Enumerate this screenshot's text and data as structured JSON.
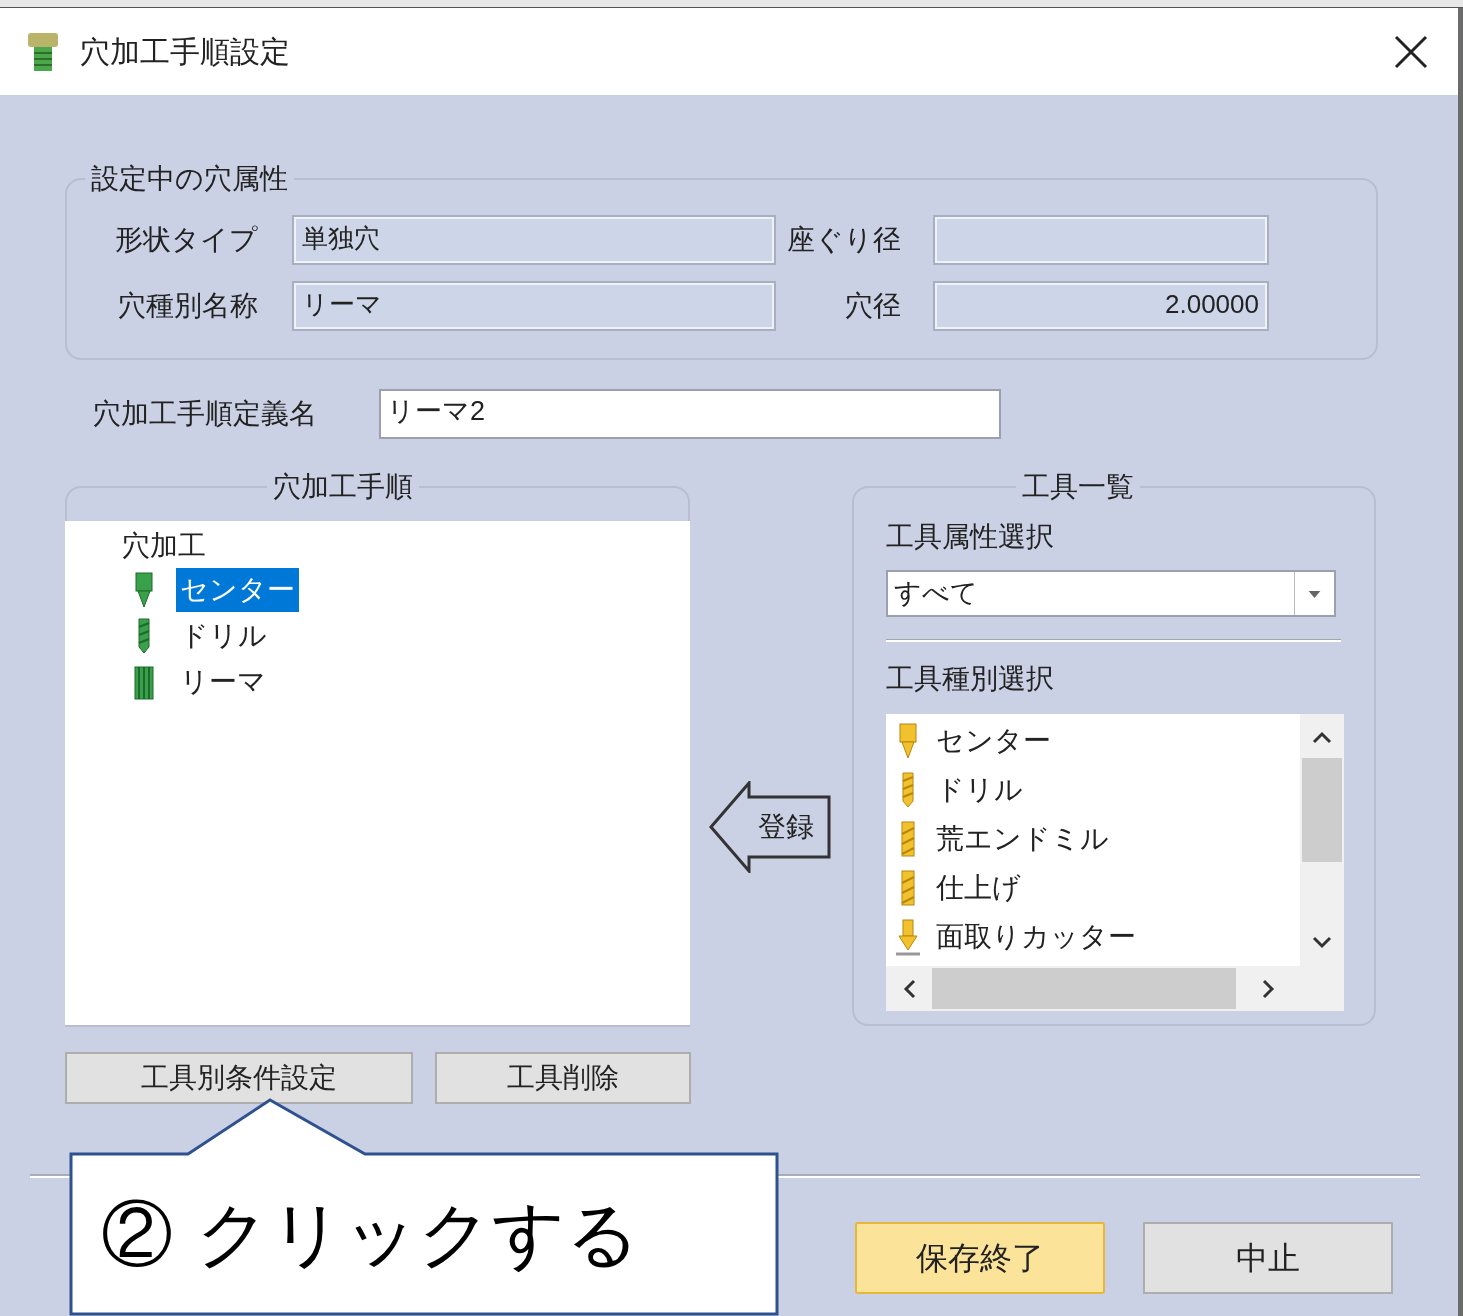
{
  "window": {
    "title": "穴加工手順設定"
  },
  "hole_attributes": {
    "title": "設定中の穴属性",
    "fields": [
      {
        "label": "形状タイプ",
        "value": "単独穴",
        "kind": "text"
      },
      {
        "label": "座ぐり径",
        "kind": "numeric"
      },
      {
        "label": "穴種別名称",
        "value": "リーマ",
        "kind": "text"
      },
      {
        "label": "穴径",
        "value": "2.00000",
        "kind": "numeric"
      }
    ]
  },
  "procedure_name": {
    "label": "穴加工手順定義名",
    "value": "リーマ2"
  },
  "procedure": {
    "title": "穴加工手順",
    "tree": [
      {
        "label": "穴加工",
        "children": [
          {
            "label": "センター",
            "kind": "center",
            "selected": true
          },
          {
            "label": "ドリル",
            "kind": "drill",
            "selected": false
          },
          {
            "label": "リーマ",
            "kind": "reamer",
            "selected": false
          }
        ]
      }
    ]
  },
  "register_button": "登録",
  "tool_list": {
    "title": "工具一覧",
    "attribute_label": "工具属性選択",
    "attribute_value": "すべて",
    "type_label": "工具種別選択",
    "types": [
      {
        "label": "センター",
        "kind": "center",
        "selected": false
      },
      {
        "label": "ドリル",
        "kind": "drill",
        "selected": false
      },
      {
        "label": "荒エンドミル",
        "kind": "endmill",
        "selected": false
      },
      {
        "label": "仕上げ",
        "kind": "endmill",
        "selected": false
      },
      {
        "label": "面取りカッター",
        "kind": "chamfer",
        "selected": false
      }
    ]
  },
  "buttons": {
    "tool_conditions": "工具別条件設定",
    "tool_delete": "工具削除",
    "save": "保存終了",
    "cancel": "中止"
  },
  "callout": "② クリックする"
}
